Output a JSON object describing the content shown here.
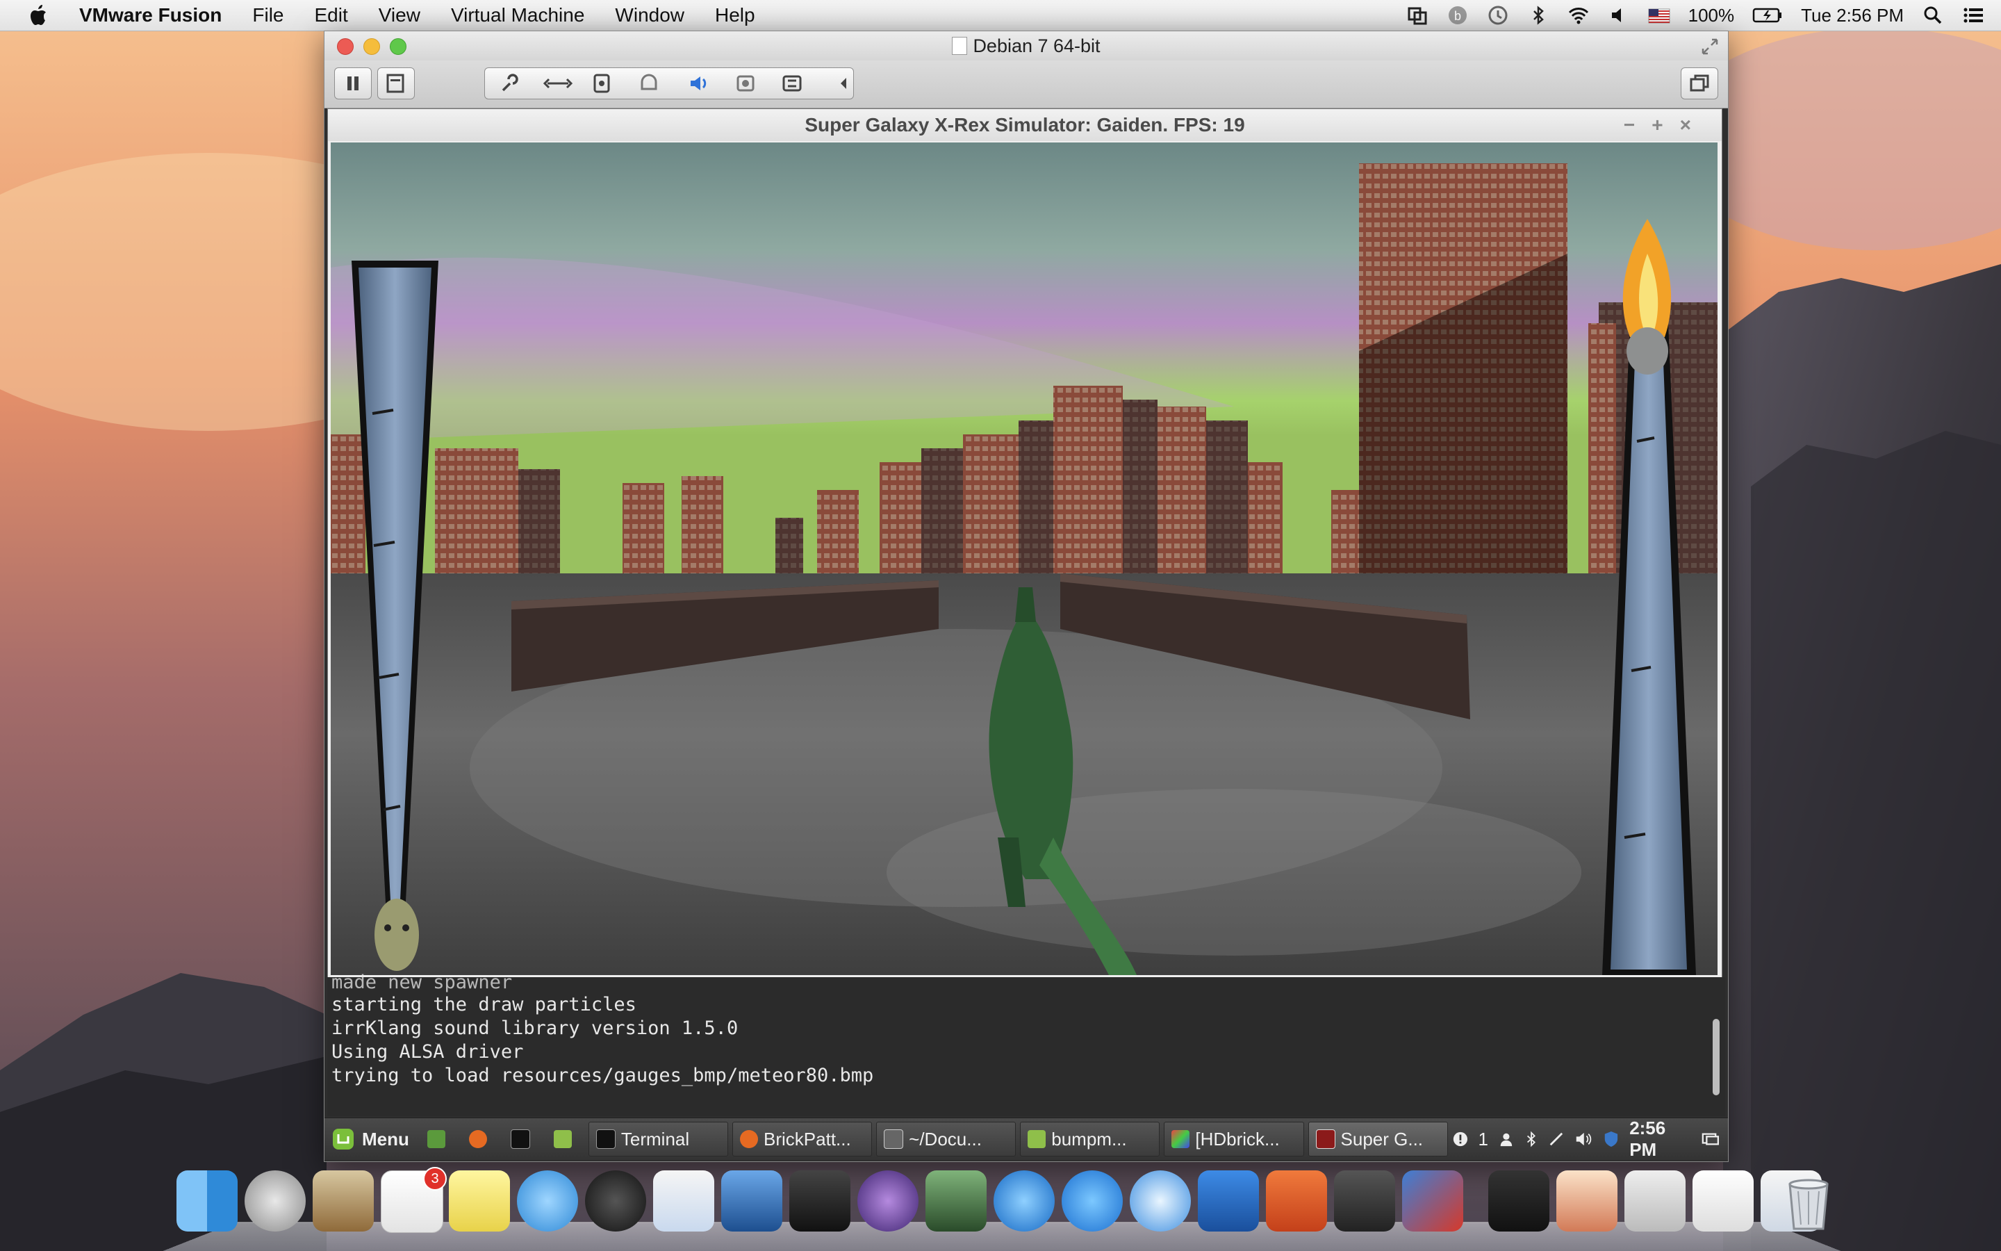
{
  "menubar": {
    "app_name": "VMware Fusion",
    "menus": [
      "File",
      "Edit",
      "View",
      "Virtual Machine",
      "Window",
      "Help"
    ],
    "battery": "100%",
    "clock": "Tue 2:56 PM"
  },
  "fusion": {
    "title": "Debian 7 64-bit"
  },
  "game": {
    "title": "Super Galaxy X-Rex Simulator: Gaiden. FPS: 19"
  },
  "terminal": {
    "lines": [
      "made new spawner",
      "starting the draw particles",
      "irrKlang sound library version 1.5.0",
      "Using ALSA driver",
      "trying to load resources/gauges_bmp/meteor80.bmp"
    ]
  },
  "taskbar": {
    "menu_label": "Menu",
    "windows": [
      "Terminal",
      "BrickPatt...",
      "~/Docu...",
      "bumpm...",
      "[HDbrick...",
      "Super G..."
    ],
    "workspace": "1",
    "clock": "2:56 PM"
  },
  "dock": {
    "mail_badge": "3"
  },
  "colors": {
    "gauge_blue": "#6f8fb2",
    "dino_green": "#2f5e35",
    "brick": "#8a4a3a",
    "sky_purple": "#b592c6",
    "sky_green": "#a4d66a"
  }
}
